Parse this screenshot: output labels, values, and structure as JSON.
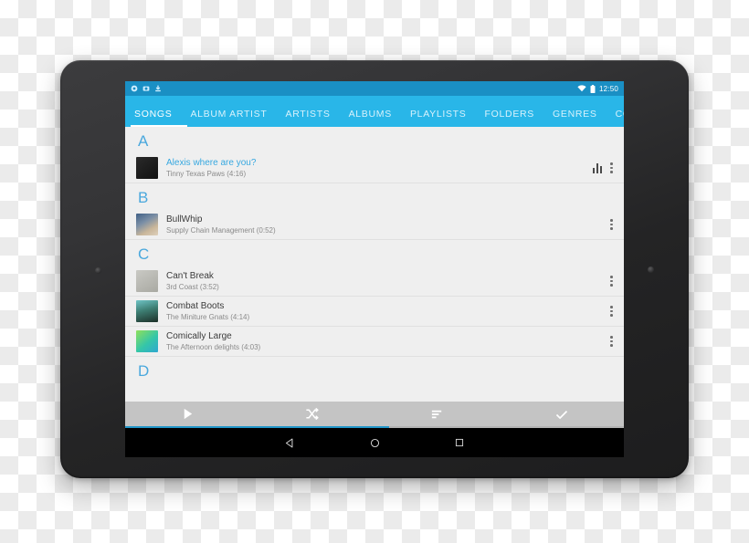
{
  "status_bar": {
    "icons": [
      "notification-dot-icon",
      "screenshot-icon",
      "download-icon"
    ],
    "wifi_icon": "wifi-icon",
    "battery_icon": "battery-icon",
    "time": "12:50"
  },
  "tabs": [
    {
      "label": "SONGS",
      "active": true
    },
    {
      "label": "ALBUM ARTIST",
      "active": false
    },
    {
      "label": "ARTISTS",
      "active": false
    },
    {
      "label": "ALBUMS",
      "active": false
    },
    {
      "label": "PLAYLISTS",
      "active": false
    },
    {
      "label": "FOLDERS",
      "active": false
    },
    {
      "label": "GENRES",
      "active": false
    },
    {
      "label": "COM",
      "active": false
    }
  ],
  "sections": [
    {
      "letter": "A",
      "songs": [
        {
          "title": "Alexis where are you?",
          "subtitle": "Tinny Texas Paws (4:16)",
          "playing": true,
          "art": "linear-gradient(140deg,#2a2a2a,#111)",
          "has_eq": true
        }
      ]
    },
    {
      "letter": "B",
      "songs": [
        {
          "title": "BullWhip",
          "subtitle": "Supply Chain Management (0:52)",
          "playing": false,
          "art": "linear-gradient(150deg,#3f5f86 0%,#7b8fa6 38%,#c9b69a 70%,#ded0bb 100%)",
          "has_eq": false
        }
      ]
    },
    {
      "letter": "C",
      "songs": [
        {
          "title": "Can't Break",
          "subtitle": "3rd Coast (3:52)",
          "playing": false,
          "art": "linear-gradient(150deg,#c9c9c4,#a9a9a2)",
          "has_eq": false
        },
        {
          "title": "Combat Boots",
          "subtitle": "The Miniture Gnats (4:14)",
          "playing": false,
          "art": "linear-gradient(165deg,#6fc4c6 0%,#3d7d72 45%,#1d2f28 100%)",
          "has_eq": false
        },
        {
          "title": "Comically Large",
          "subtitle": "The Afternoon delights (4:03)",
          "playing": false,
          "art": "linear-gradient(140deg,#8fe05a 0%,#35c6a8 55%,#2fa7d0 100%)",
          "has_eq": false
        }
      ]
    },
    {
      "letter": "D",
      "songs": []
    }
  ],
  "action_bar": {
    "buttons": [
      {
        "name": "play-all-button",
        "icon": "play-icon"
      },
      {
        "name": "shuffle-button",
        "icon": "shuffle-icon"
      },
      {
        "name": "sort-button",
        "icon": "sort-icon"
      },
      {
        "name": "select-done-button",
        "icon": "check-icon"
      }
    ]
  },
  "progress": {
    "percent": 53
  },
  "now_playing": {
    "title": "Alexis where are you?",
    "artist": "Tinny Texas Paws",
    "art": "linear-gradient(140deg,#2a2a2a,#111)",
    "controls": [
      {
        "name": "previous-button",
        "icon": "skip-previous-icon"
      },
      {
        "name": "pause-button",
        "icon": "pause-icon"
      },
      {
        "name": "next-button",
        "icon": "skip-next-icon"
      },
      {
        "name": "overflow-button",
        "icon": "more-vertical-icon"
      }
    ]
  },
  "nav_bar": {
    "back": "back-triangle-icon",
    "home": "home-circle-icon",
    "recents": "recents-square-icon"
  },
  "colors": {
    "accent": "#29b6e8",
    "status_bar": "#1a8fc4",
    "progress_fill": "#2196c9",
    "section_letter": "#4aa8dd",
    "bezel": "#2b2b2d"
  }
}
